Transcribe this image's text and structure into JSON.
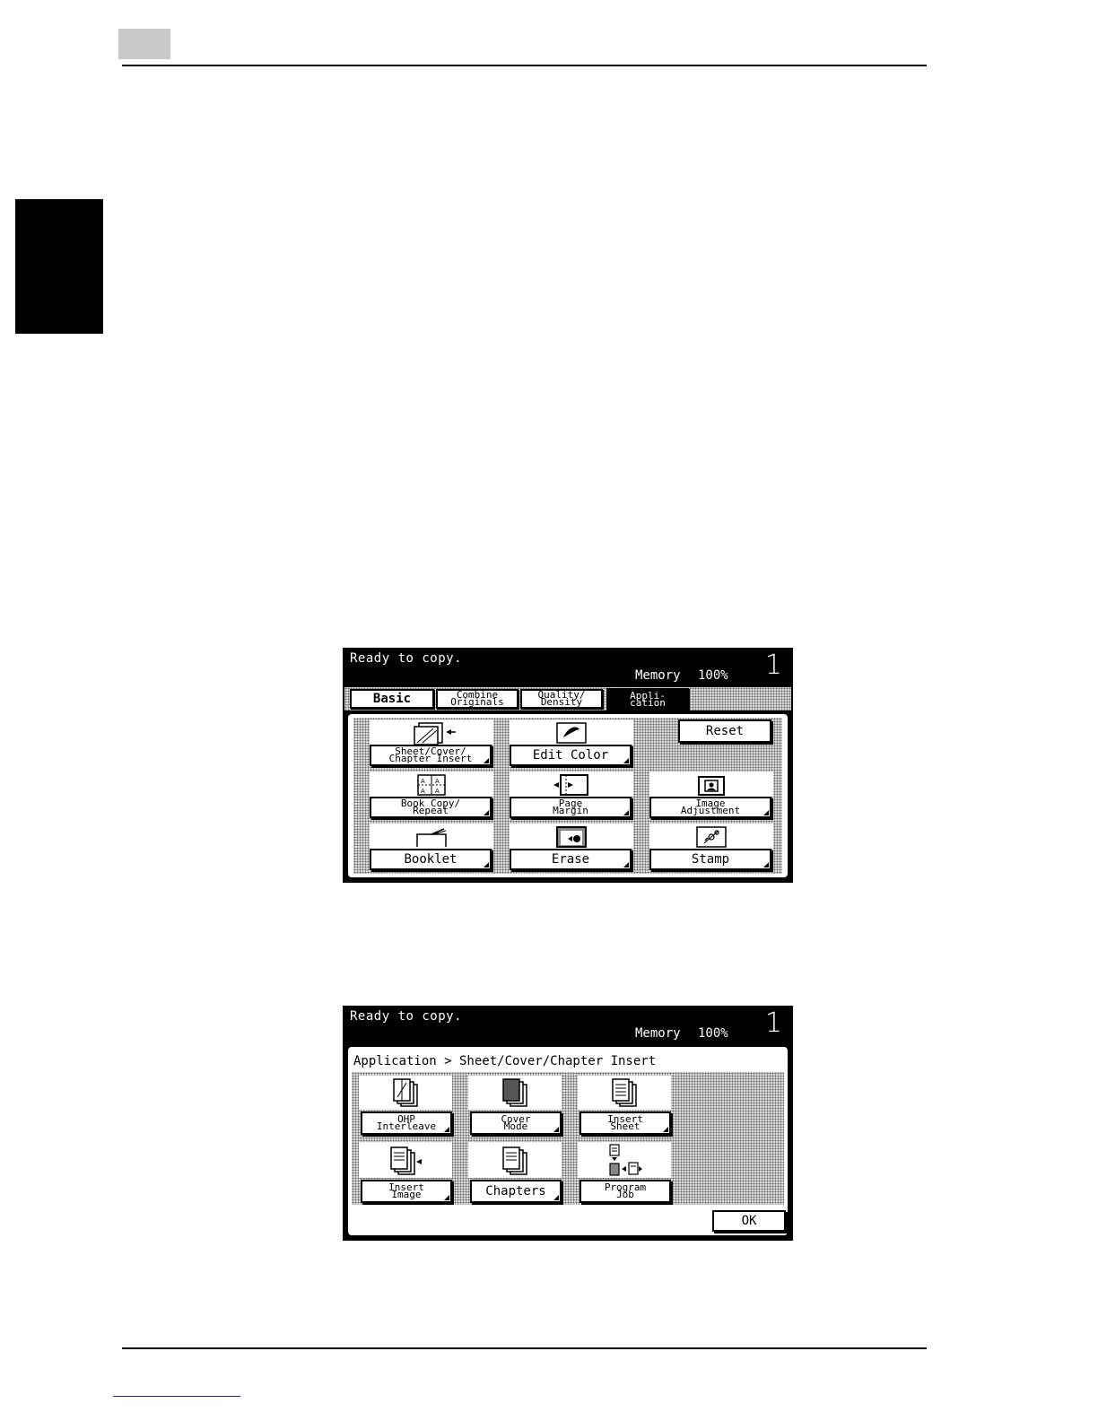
{
  "screen1": {
    "status_text": "Ready to copy.",
    "memory_label": "Memory",
    "memory_value": "100%",
    "copy_count": "1",
    "tabs": [
      {
        "line1": "Basic",
        "line2": ""
      },
      {
        "line1": "Combine",
        "line2": "Originals"
      },
      {
        "line1": "Quality/",
        "line2": "Density"
      },
      {
        "line1": "Appli-",
        "line2": "cation"
      }
    ],
    "buttons": {
      "sheet_insert": {
        "line1": "Sheet/Cover/",
        "line2": "Chapter Insert"
      },
      "edit_color": "Edit Color",
      "reset": "Reset",
      "book_copy": {
        "line1": "Book Copy/",
        "line2": "Repeat"
      },
      "page_margin": {
        "line1": "Page",
        "line2": "Margin"
      },
      "image_adjustment": {
        "line1": "Image",
        "line2": "Adjustment"
      },
      "booklet": "Booklet",
      "erase": "Erase",
      "stamp": "Stamp"
    }
  },
  "screen2": {
    "status_text": "Ready to copy.",
    "memory_label": "Memory",
    "memory_value": "100%",
    "copy_count": "1",
    "breadcrumb": "Application > Sheet/Cover/Chapter Insert",
    "buttons": {
      "ohp_interleave": {
        "line1": "OHP",
        "line2": "Interleave"
      },
      "cover_mode": {
        "line1": "Cover",
        "line2": "Mode"
      },
      "insert_sheet": {
        "line1": "Insert",
        "line2": "Sheet"
      },
      "insert_image": {
        "line1": "Insert",
        "line2": "Image"
      },
      "chapters": "Chapters",
      "program_job": {
        "line1": "Program",
        "line2": "Job"
      },
      "ok": "OK"
    }
  }
}
